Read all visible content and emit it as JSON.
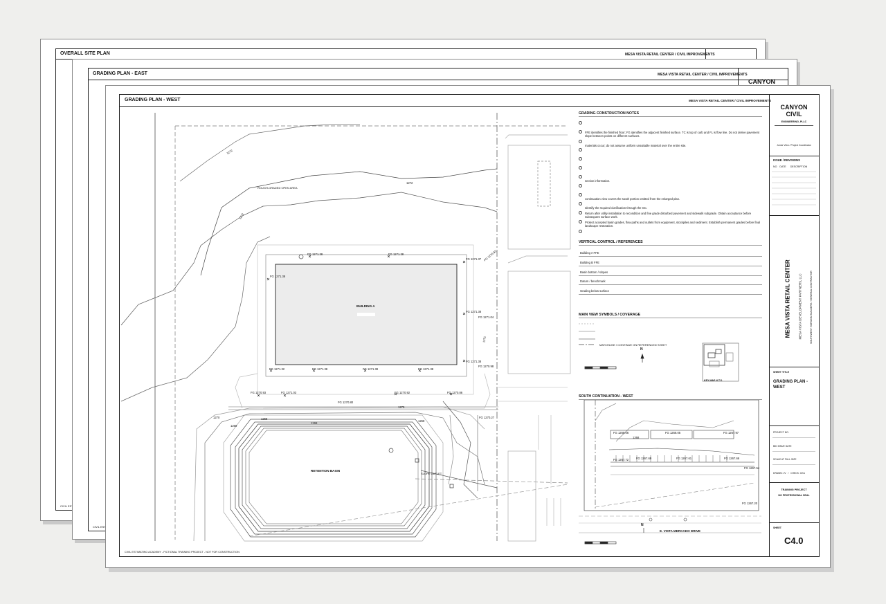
{
  "sheets": {
    "back": {
      "title": "OVERALL SITE PLAN",
      "project_line": "MESA VISTA RETAIL CENTER  /  CIVIL IMPROVEMENTS",
      "footer": "CIVIL ESTIMATING"
    },
    "middle": {
      "title": "GRADING PLAN - EAST",
      "project_line": "MESA VISTA RETAIL CENTER  /  CIVIL IMPROVEMENTS",
      "firm_partial": "CANYON",
      "footer": "CIVIL ESTIMATING"
    },
    "front": {
      "title": "GRADING PLAN - WEST",
      "project_line": "MESA VISTA RETAIL CENTER  /  CIVIL IMPROVEMENTS",
      "footer": "CIVIL ESTIMATING ACADEMY - FICTIONAL TRAINING PROJECT - NOT FOR CONSTRUCTION"
    }
  },
  "notes": {
    "heading": "GRADING CONSTRUCTION NOTES",
    "items": [
      "",
      "FFE identifies the finished floor; FG identifies the adjacent finished surface. TC is top of curb and FL is flow line. Do not derive pavement slope between points on different surfaces.",
      "materials occur; do not assume uniform unsuitable material over the entire site.",
      "",
      "",
      "",
      "section information.",
      "",
      "continuation view covers the south portion omitted from the enlarged plan.",
      "Identify the required clarification through the GC.",
      "Return after utility installation to recondition and fine grade disturbed pavement and sidewalk subgrade. Obtain acceptance before subsequent surface work.",
      "Protect accepted basin grades, flow paths and outlets from equipment, stockpiles and sediment. Establish permanent grades before final landscape restoration.",
      ""
    ]
  },
  "vertical": {
    "heading": "VERTICAL CONTROL / REFERENCES",
    "rows": [
      "Building A FFE",
      "Building B FFE",
      "Basin bottom / slopes",
      "Datum / benchmark",
      "Grading below surface"
    ]
  },
  "symbols": {
    "heading": "MAIN VIEW SYMBOLS / COVERAGE",
    "matchline": "MATCHLINE / CONTINUE ON REFERENCED SHEET",
    "keymap": "KEY MAP  N.T.S."
  },
  "continuation": {
    "heading": "SOUTH CONTINUATION - WEST",
    "street": "E. VISTA MERCADO DRIVE",
    "labels": [
      "FG 1268.06",
      "FG 1268.05",
      "FG 1267.97",
      "1268",
      "FG 1267.72",
      "FG 1267.69",
      "FG 1267.61",
      "FG 1267.66",
      "FG 1267.54",
      "FG 1267.20"
    ]
  },
  "plan": {
    "building": "BUILDING A",
    "basin": "RETENTION BASIN",
    "rough": "ROUGH-GRADED OPEN AREA",
    "slope_outlet": "SLOPE OUTLET",
    "contours": [
      "1272",
      "1272",
      "1272",
      "1271",
      "1270",
      "1270",
      "1269",
      "1268",
      "1269",
      "1268"
    ],
    "spot_elevations": [
      "FG 1271.38",
      "FG 1271.38",
      "FG 1271.37",
      "FG 1270.92",
      "FG 1271.38",
      "FG 1271.38",
      "FG 1271.04",
      "FG 1271.38",
      "FG 1270.98",
      "FG 1271.32",
      "FG 1271.38",
      "FG 1271.38",
      "FG 1271.38",
      "FG 1270.93",
      "FG 1271.03",
      "FG 1270.92",
      "FG 1270.86",
      "FG 1270.80",
      "FG 1270.27"
    ]
  },
  "titleblock": {
    "firm": "CANYON\nCIVIL",
    "firm_sub": "ENGINEERING, PLLC",
    "role_line": "Junior View / Project Coordinator",
    "issue_heading": "ISSUE / REVISIONS",
    "issue_cols": "NO    DATE      DESCRIPTION",
    "project": "MESA VISTA RETAIL CENTER",
    "owner": "MESA VISTA DEVELOPMENT PARTNERS, LLC",
    "gc": "SOUTHWEST HORIZON BUILDERS / GENERAL CONTRACTOR",
    "sheet_title_label": "SHEET TITLE",
    "sheet_title": "GRADING PLAN -\nWEST",
    "project_no": "PROJECT NO.",
    "bid_date": "BID ISSUE DATE",
    "scale": "SCALE AT FULL SIZE",
    "drawn": "DRAWN: JV   /   CHECK: CEA",
    "training": "TRAINING PROJECT",
    "no_seal": "NO PROFESSIONAL SEAL",
    "sheet_label": "SHEET",
    "sheet_no": "C4.0"
  },
  "north": "N"
}
